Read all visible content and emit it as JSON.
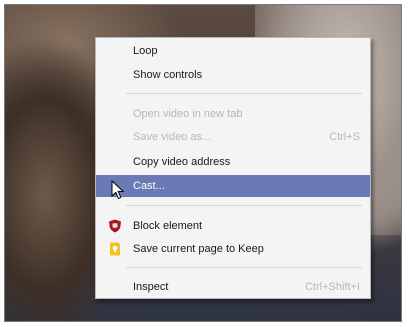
{
  "context_menu": {
    "items": {
      "loop": {
        "label": "Loop"
      },
      "show_controls": {
        "label": "Show controls"
      },
      "open_video": {
        "label": "Open video in new tab",
        "disabled": true
      },
      "save_video": {
        "label": "Save video as...",
        "shortcut": "Ctrl+S",
        "disabled": true
      },
      "copy_address": {
        "label": "Copy video address"
      },
      "cast": {
        "label": "Cast...",
        "highlighted": true
      },
      "block_element": {
        "label": "Block element",
        "icon": "ublock-shield-icon"
      },
      "save_to_keep": {
        "label": "Save current page to Keep",
        "icon": "keep-bulb-icon"
      },
      "inspect": {
        "label": "Inspect",
        "shortcut": "Ctrl+Shift+I"
      }
    }
  },
  "colors": {
    "highlight": "#6a7ab4",
    "menu_bg": "#f4f4f4",
    "disabled_text": "#b7b7b7",
    "ublock_red": "#a3171d",
    "keep_yellow": "#f6c223"
  }
}
